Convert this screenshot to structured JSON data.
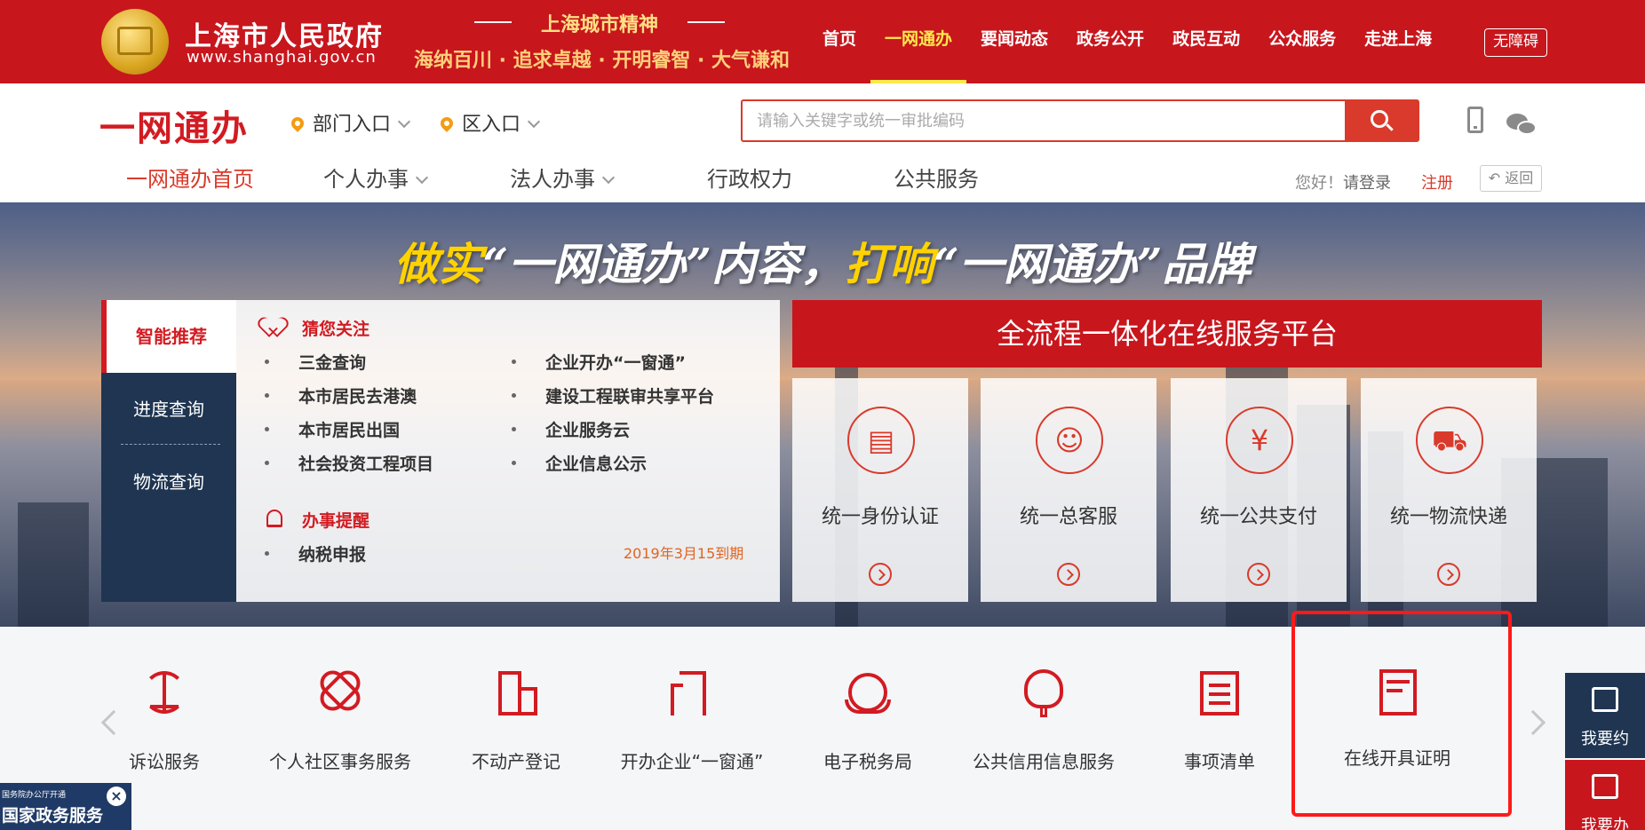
{
  "site": {
    "name": "上海市人民政府",
    "url": "www.shanghai.gov.cn",
    "spirit_title": "上海城市精神",
    "spirit_sub": "海纳百川 · 追求卓越 · 开明睿智 · 大气谦和",
    "accessibility": "无障碍",
    "nav": [
      "首页",
      "一网通办",
      "要闻动态",
      "政务公开",
      "政民互动",
      "公众服务",
      "走进上海"
    ],
    "active_nav": "一网通办"
  },
  "header": {
    "brand": "一网通办",
    "dept_entry": "部门入口",
    "district_entry": "区入口",
    "search_placeholder": "请输入关键字或统一审批编码",
    "subnav": [
      "一网通办首页",
      "个人办事",
      "法人办事",
      "行政权力",
      "公共服务"
    ],
    "greeting": "您好！",
    "login": "请登录",
    "register": "注册",
    "back": "返回"
  },
  "banner": {
    "slogan_a": "做实",
    "slogan_b": "“一网通办”内容，",
    "slogan_c": "打响",
    "slogan_d": "“一网通办”品牌",
    "side_tabs": [
      "智能推荐",
      "进度查询",
      "物流查询"
    ],
    "attention_title": "猜您关注",
    "attention_left": [
      "三金查询",
      "本市居民去港澳",
      "本市居民出国",
      "社会投资工程项目"
    ],
    "attention_right": [
      "企业开办“一窗通”",
      "建设工程联审共享平台",
      "企业服务云",
      "企业信息公示"
    ],
    "reminder_title": "办事提醒",
    "reminder_item": "纳税申报",
    "reminder_due": "2019年3月15到期",
    "platform_title": "全流程一体化在线服务平台",
    "platform_cards": [
      {
        "label": "统一身份认证",
        "icon": "id-card-icon"
      },
      {
        "label": "统一总客服",
        "icon": "customer-service-icon"
      },
      {
        "label": "统一公共支付",
        "icon": "payment-icon"
      },
      {
        "label": "统一物流快递",
        "icon": "delivery-truck-icon"
      }
    ]
  },
  "services": [
    {
      "label": "诉讼服务",
      "icon": "scales-icon"
    },
    {
      "label": "个人社区事务服务",
      "icon": "community-icon"
    },
    {
      "label": "不动产登记",
      "icon": "building-icon"
    },
    {
      "label": "开办企业“一窗通”",
      "icon": "enterprise-icon"
    },
    {
      "label": "电子税务局",
      "icon": "tax-icon"
    },
    {
      "label": "公共信用信息服务",
      "icon": "credit-icon"
    },
    {
      "label": "事项清单",
      "icon": "list-icon"
    },
    {
      "label": "在线开具证明",
      "icon": "certificate-icon"
    }
  ],
  "float": {
    "appointment": "我要约",
    "handle": "我要办"
  },
  "gov_badge": {
    "small": "国务院办公厅开通",
    "big": "国家政务服务"
  },
  "colors": {
    "primary_red": "#c8161d",
    "navy": "#1f3551",
    "highlight": "#ff1a1a"
  }
}
